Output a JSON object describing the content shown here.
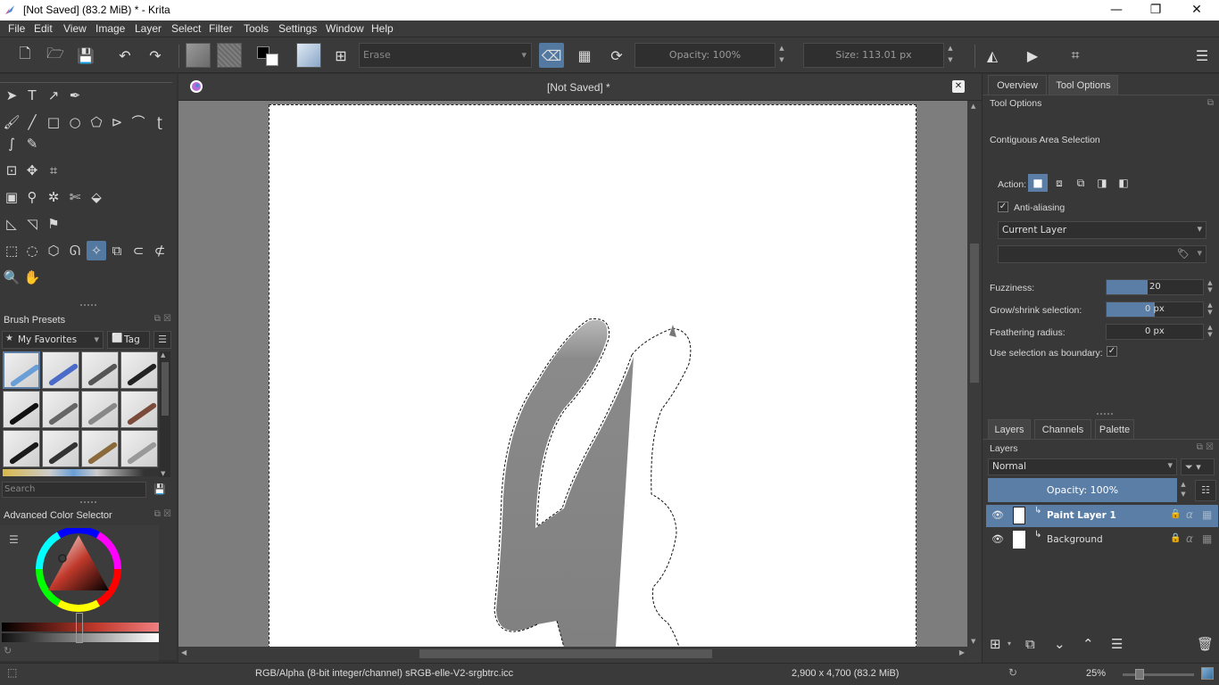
{
  "window": {
    "title": "[Not Saved]  (83.2 MiB)  * - Krita",
    "minimize_glyph": "—",
    "maximize_glyph": "❐",
    "close_glyph": "✕"
  },
  "menu": [
    "File",
    "Edit",
    "View",
    "Image",
    "Layer",
    "Select",
    "Filter",
    "Tools",
    "Settings",
    "Window",
    "Help"
  ],
  "toolbar": {
    "blend_mode": "Erase",
    "opacity": "Opacity: 100%",
    "size": "Size: 113.01 px"
  },
  "brush_presets": {
    "title": "Brush Presets",
    "tag_filter": "My Favorites",
    "tag_button": "Tag",
    "search_placeholder": "Search"
  },
  "color_selector": {
    "title": "Advanced Color Selector"
  },
  "document": {
    "tab_title": "[Not Saved]  *"
  },
  "right_panel": {
    "tabs": [
      "Overview",
      "Tool Options"
    ],
    "section_title": "Tool Options",
    "tool_name": "Contiguous Area Selection",
    "action_label": "Action:",
    "anti_aliasing_label": "Anti-aliasing",
    "anti_aliasing_checked": true,
    "source_layer": "Current Layer",
    "fuzziness_label": "Fuzziness:",
    "fuzziness_value": "20",
    "fuzziness_fraction": 0.43,
    "grow_label": "Grow/shrink selection:",
    "grow_value": "0 px",
    "feather_label": "Feathering radius:",
    "feather_value": "0 px",
    "boundary_label": "Use selection as boundary:",
    "boundary_checked": true
  },
  "layers_panel": {
    "tabs": [
      "Layers",
      "Channels",
      "Palette"
    ],
    "title": "Layers",
    "blend_mode": "Normal",
    "opacity": "Opacity:  100%",
    "layers": [
      {
        "name": "Paint Layer 1",
        "selected": true
      },
      {
        "name": "Background",
        "selected": false
      }
    ]
  },
  "statusbar": {
    "color_profile": "RGB/Alpha (8-bit integer/channel)  sRGB-elle-V2-srgbtrc.icc",
    "image_size": "2,900 x 4,700 (83.2 MiB)",
    "zoom": "25%"
  },
  "colors": {
    "accent": "#5a7ea6",
    "panel_bg": "#383838",
    "canvas_bg": "#7d7d7d",
    "stroke_gray": "#808080"
  }
}
